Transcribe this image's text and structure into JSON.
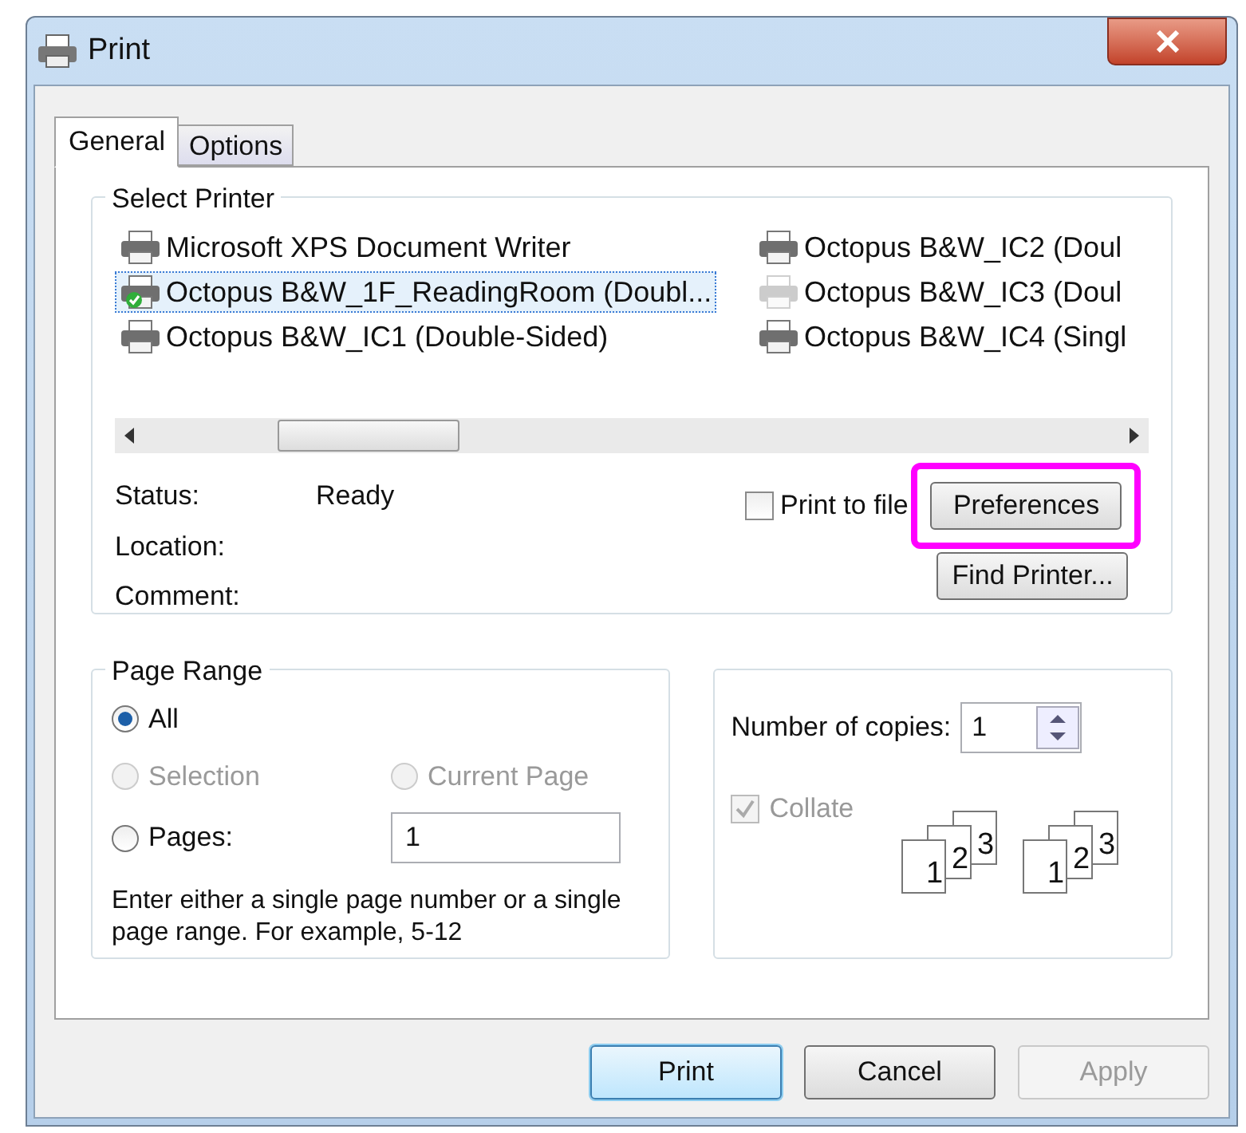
{
  "window": {
    "title": "Print"
  },
  "tabs": [
    {
      "label": "General",
      "selected": true
    },
    {
      "label": "Options",
      "selected": false
    }
  ],
  "select_printer": {
    "title": "Select Printer",
    "printers": [
      {
        "name": "Microsoft XPS Document Writer",
        "selected": false,
        "default": false,
        "dimmed": false
      },
      {
        "name": "Octopus B&W_1F_ReadingRoom (Doubl...",
        "selected": true,
        "default": true,
        "dimmed": false
      },
      {
        "name": "Octopus B&W_IC1 (Double-Sided)",
        "selected": false,
        "default": false,
        "dimmed": false
      },
      {
        "name": "Octopus B&W_IC2 (Doul",
        "selected": false,
        "default": false,
        "dimmed": false
      },
      {
        "name": "Octopus B&W_IC3 (Doul",
        "selected": false,
        "default": false,
        "dimmed": true
      },
      {
        "name": "Octopus B&W_IC4 (Singl",
        "selected": false,
        "default": false,
        "dimmed": false
      }
    ],
    "info": [
      {
        "label": "Status:",
        "value": "Ready"
      },
      {
        "label": "Location:"
      },
      {
        "label": "Comment:"
      }
    ],
    "print_to_file": {
      "label": "Print to file",
      "checked": false
    },
    "preferences": {
      "label": "Preferences",
      "highlighted": true
    },
    "find_printer": "Find Printer..."
  },
  "page_range": {
    "title": "Page Range",
    "options": [
      {
        "label": "All",
        "selected": true,
        "disabled": false
      },
      {
        "label": "Selection",
        "selected": false,
        "disabled": true
      },
      {
        "label": "Current Page",
        "selected": false,
        "disabled": true
      },
      {
        "label": "Pages:",
        "selected": false,
        "disabled": false
      }
    ],
    "pages_value": "1",
    "hint": "Enter either a single page number or a single page range.  For example, 5-12"
  },
  "copies": {
    "label": "Number of copies:",
    "value": "1",
    "collate": {
      "label": "Collate",
      "checked": true,
      "disabled": true
    },
    "collate_stacks": [
      {
        "pages": [
          "1",
          "2",
          "3"
        ]
      },
      {
        "pages": [
          "1",
          "2",
          "3"
        ]
      }
    ]
  },
  "buttons": [
    {
      "label": "Print",
      "kind": "default",
      "disabled": false
    },
    {
      "label": "Cancel",
      "kind": "normal",
      "disabled": false
    },
    {
      "label": "Apply",
      "kind": "normal",
      "disabled": true
    }
  ]
}
